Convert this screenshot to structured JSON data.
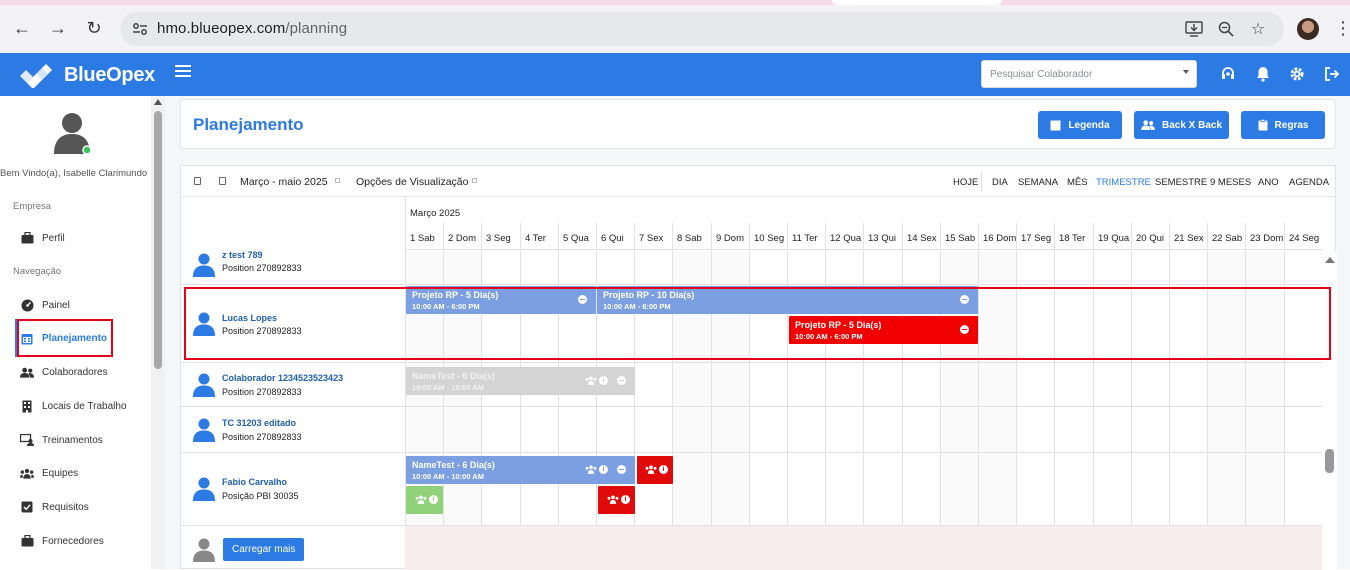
{
  "browser": {
    "url_host": "hmo.blueopex.com",
    "url_path": "/planning"
  },
  "app": {
    "brand": "BlueOpex",
    "search_placeholder": "Pesquisar Colaborador",
    "accent_color": "#2c7be5"
  },
  "sidebar": {
    "welcome": "Bem Vindo(a), Isabelle Clarimundo",
    "section_company": "Empresa",
    "section_nav": "Navegação",
    "items": [
      {
        "label": "Perfil",
        "icon": "briefcase-icon"
      },
      {
        "label": "Painel",
        "icon": "dashboard-icon"
      },
      {
        "label": "Planejamento",
        "icon": "calendar-icon"
      },
      {
        "label": "Colaboradores",
        "icon": "users-icon"
      },
      {
        "label": "Locais de Trabalho",
        "icon": "building-icon"
      },
      {
        "label": "Treinamentos",
        "icon": "training-icon"
      },
      {
        "label": "Equipes",
        "icon": "team-icon"
      },
      {
        "label": "Requisitos",
        "icon": "checkbox-icon"
      },
      {
        "label": "Fornecedores",
        "icon": "briefcase-icon"
      }
    ]
  },
  "page": {
    "title": "Planejamento",
    "btn_legend": "Legenda",
    "btn_backxback": "Back X Back",
    "btn_rules": "Regras"
  },
  "toolbar": {
    "range": "Março - maio 2025",
    "view_options": "Opções de Visualização",
    "views": [
      "HOJE",
      "DIA",
      "SEMANA",
      "MÊS",
      "TRIMESTRE",
      "SEMESTRE",
      "9 MESES",
      "ANO",
      "AGENDA"
    ],
    "selected_view": "TRIMESTRE"
  },
  "timeline": {
    "month": "Março 2025",
    "days": [
      "1 Sab",
      "2 Dom",
      "3 Seg",
      "4 Ter",
      "5 Qua",
      "6 Qui",
      "7 Sex",
      "8 Sab",
      "9 Dom",
      "10 Seg",
      "11 Ter",
      "12 Qua",
      "13 Qui",
      "14 Sex",
      "15 Sab",
      "16 Dom",
      "17 Seg",
      "18 Ter",
      "19 Qua",
      "20 Qui",
      "21 Sex",
      "22 Sab",
      "23 Dom",
      "24 Seg"
    ]
  },
  "rows": [
    {
      "name": "z test 789",
      "position": "Position 270892833"
    },
    {
      "name": "Lucas Lopes",
      "position": "Position 270892833"
    },
    {
      "name": "Colaborador 1234523523423",
      "position": "Position 270892833"
    },
    {
      "name": "TC 31203 editado",
      "position": "Position 270892833"
    },
    {
      "name": "Fabio Carvalho",
      "position": "Posição PBI 30035"
    }
  ],
  "events": {
    "ev1_title": "Projeto RP - 5 Dia(s)",
    "ev1_time": "10:00 AM - 6:00 PM",
    "ev2_title": "Projeto RP - 10 Dia(s)",
    "ev2_time": "10:00 AM - 6:00 PM",
    "ev3_title": "Projeto RP - 5 Dia(s)",
    "ev3_time": "10:00 AM - 6:00 PM",
    "ev4_title": "NameTest - 6 Dia(s)",
    "ev4_time": "10:00 AM - 10:00 AM",
    "ev5_title": "NameTest - 6 Dia(s)",
    "ev5_time": "10:00 AM - 10:00 AM"
  },
  "load_more": "Carregar mais"
}
